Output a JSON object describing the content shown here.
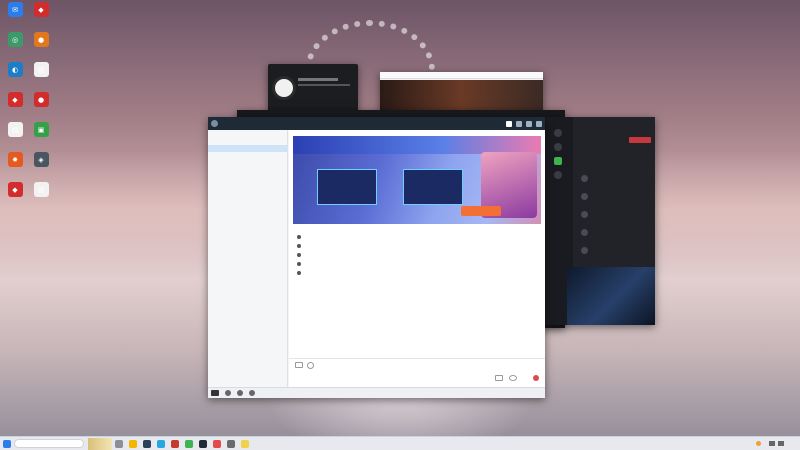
{
  "desktop": {
    "icons": [
      {
        "label": "",
        "color": "#2b7de9",
        "glyph": "✉"
      },
      {
        "label": "",
        "color": "#3a9a6a",
        "glyph": "◎"
      },
      {
        "label": "",
        "color": "#1d7ec7",
        "glyph": "◐"
      },
      {
        "label": "",
        "color": "#d22c2c",
        "glyph": "◆"
      },
      {
        "label": "",
        "color": "#f2f2f2",
        "glyph": "▤"
      },
      {
        "label": "",
        "color": "#e75a1f",
        "glyph": "✸"
      },
      {
        "label": "",
        "color": "#d22c2c",
        "glyph": "◆"
      },
      {
        "label": "",
        "color": "#d22c2c",
        "glyph": "◆"
      },
      {
        "label": "",
        "color": "#e1781e",
        "glyph": "●"
      },
      {
        "label": "",
        "color": "#f2f2f2",
        "glyph": "▤"
      },
      {
        "label": "",
        "color": "#d22c2c",
        "glyph": "●"
      },
      {
        "label": "",
        "color": "#34a04a",
        "glyph": "▣"
      },
      {
        "label": "",
        "color": "#4a5562",
        "glyph": "◈"
      },
      {
        "label": "",
        "color": "#f2f2f2",
        "glyph": "▤"
      }
    ]
  },
  "chat": {
    "title": "",
    "group_list_header": "",
    "groups": [
      {
        "label": "",
        "selected": false
      },
      {
        "label": "",
        "selected": true
      },
      {
        "label": "",
        "selected": false
      }
    ],
    "banner_title": "",
    "banner_button": "",
    "messages": [
      "",
      "",
      "",
      "",
      ""
    ],
    "footer": {
      "left": "",
      "middle": "",
      "right": ""
    },
    "send_icon": "send-icon"
  },
  "steam": {
    "balance": "",
    "section_title": "",
    "rows": [
      "",
      "",
      "",
      "",
      ""
    ]
  },
  "taskbar": {
    "search_placeholder": "",
    "clock_time": "",
    "clock_date": "",
    "weather": ""
  },
  "colors": {
    "chat_header": "#1e2a36",
    "accent_red": "#c7383f",
    "accent_blue": "#2b7de9"
  }
}
